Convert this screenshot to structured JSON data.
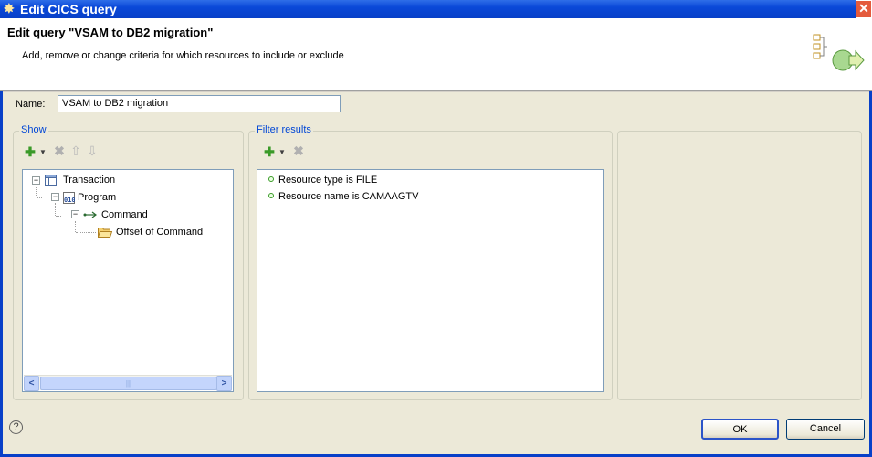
{
  "window": {
    "title": "Edit CICS query"
  },
  "header": {
    "title": "Edit query \"VSAM to DB2 migration\"",
    "description": "Add, remove or change criteria for which resources to include or exclude"
  },
  "name_field": {
    "label": "Name:",
    "value": "VSAM to DB2 migration"
  },
  "show_panel": {
    "label": "Show",
    "tree": [
      {
        "label": "Transaction",
        "icon": "table-icon",
        "expanded": true
      },
      {
        "label": "Program",
        "icon": "binary-program-icon",
        "expanded": true
      },
      {
        "label": "Command",
        "icon": "arrow-link-icon",
        "expanded": true
      },
      {
        "label": "Offset of Command",
        "icon": "folder-open-icon"
      }
    ]
  },
  "filter_panel": {
    "label": "Filter results",
    "items": [
      "Resource type is FILE",
      "Resource name is CAMAAGTV"
    ]
  },
  "buttons": {
    "ok": "OK",
    "cancel": "Cancel"
  },
  "colors": {
    "titlebar": "#0840c8",
    "group_label": "#0046d5",
    "add_green": "#3a9a28"
  }
}
